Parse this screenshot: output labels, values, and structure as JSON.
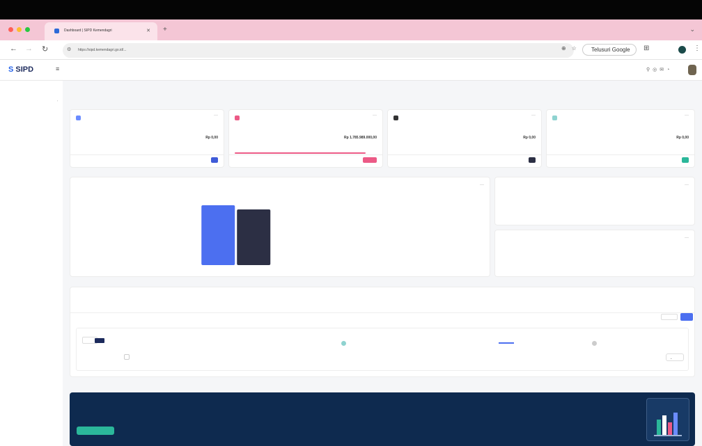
{
  "browser": {
    "tab_title": "Dashboard | SIPD Kemendagri",
    "url": "https://sipd.kemendagri.go.id/...",
    "lens_label": "Telusuri Google"
  },
  "app": {
    "logo_text": "SIPD",
    "institution_title": "",
    "institution_subtitle": ""
  },
  "sidebar": {
    "items": [
      {
        "label": "",
        "active": true
      },
      {
        "label": ""
      },
      {
        "label": ""
      },
      {
        "label": ""
      },
      {
        "label": ""
      },
      {
        "label": ""
      }
    ],
    "sections": [
      {
        "label": ""
      },
      {
        "label": ""
      },
      {
        "label": ""
      }
    ]
  },
  "breadcrumb": {
    "current": ""
  },
  "section_heading": "",
  "cards": [
    {
      "icon": "info-icon",
      "value": "Rp 0,00",
      "badge_color": "#3f5bd8",
      "icon_color": "#6b8cff",
      "accent": false
    },
    {
      "icon": "chart-icon",
      "value": "Rp 1.785.989.000,00",
      "badge_color": "#ec5a86",
      "icon_color": "#ec5a86",
      "accent": true
    },
    {
      "icon": "settings-icon",
      "value": "Rp 0,00",
      "badge_color": "#2c2f44",
      "icon_color": "#333333",
      "accent": false
    },
    {
      "icon": "refresh-icon",
      "value": "Rp 0,00",
      "badge_color": "#2bb79a",
      "icon_color": "#8fd3d0",
      "accent": false
    }
  ],
  "chart_panel": {
    "title": "",
    "icon": "bar-chart-icon",
    "colors": {
      "series_a": "#4c6ff0",
      "series_b": "#2c2f44"
    },
    "chart_data": {
      "type": "bar",
      "categories": [
        "",
        "",
        "",
        ""
      ],
      "series": [
        {
          "values": [
            0,
            100,
            0,
            0
          ]
        },
        {
          "values": [
            0,
            93,
            0,
            0
          ]
        }
      ]
    }
  },
  "calendar_panel": {
    "icon": "calendar-icon"
  },
  "qr_panel": {
    "icon": "calendar-icon"
  },
  "info_panel": {
    "title": "",
    "filter_button": "",
    "next_button": ""
  },
  "banner": {
    "title": "",
    "text": "",
    "button": ""
  }
}
